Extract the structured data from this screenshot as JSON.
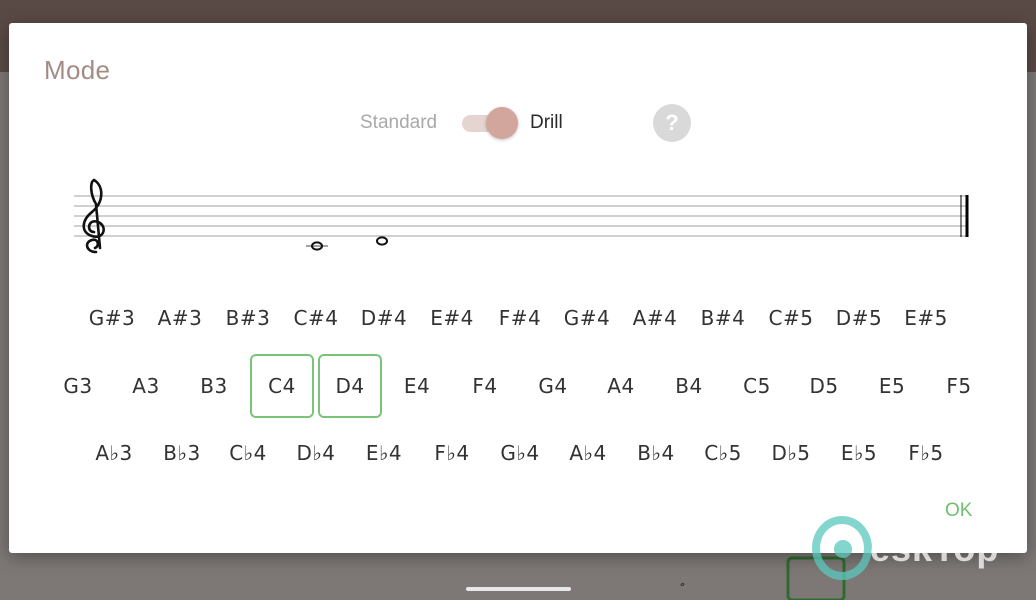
{
  "dialog": {
    "title": "Mode",
    "mode_standard": "Standard",
    "mode_drill": "Drill",
    "help_glyph": "?",
    "ok_label": "OK",
    "toggle_state": "Drill"
  },
  "notes": {
    "sharps": [
      "G#3",
      "A#3",
      "B#3",
      "C#4",
      "D#4",
      "E#4",
      "F#4",
      "G#4",
      "A#4",
      "B#4",
      "C#5",
      "D#5",
      "E#5"
    ],
    "naturals": [
      "G3",
      "A3",
      "B3",
      "C4",
      "D4",
      "E4",
      "F4",
      "G4",
      "A4",
      "B4",
      "C5",
      "D5",
      "E5",
      "F5"
    ],
    "flats": [
      "A♭3",
      "B♭3",
      "C♭4",
      "D♭4",
      "E♭4",
      "F♭4",
      "G♭4",
      "A♭4",
      "B♭4",
      "C♭5",
      "D♭5",
      "E♭5",
      "F♭5"
    ],
    "selected": [
      "C4",
      "D4"
    ]
  },
  "staff": {
    "clef": "treble-clef-icon",
    "displayed_notes": [
      "C4",
      "D4"
    ]
  },
  "watermark": {
    "text": "eskTop"
  },
  "colors": {
    "accent": "#d2a69c",
    "title": "#a48c86",
    "selected_border": "#7ac47a",
    "ok": "#6fbf6f"
  }
}
